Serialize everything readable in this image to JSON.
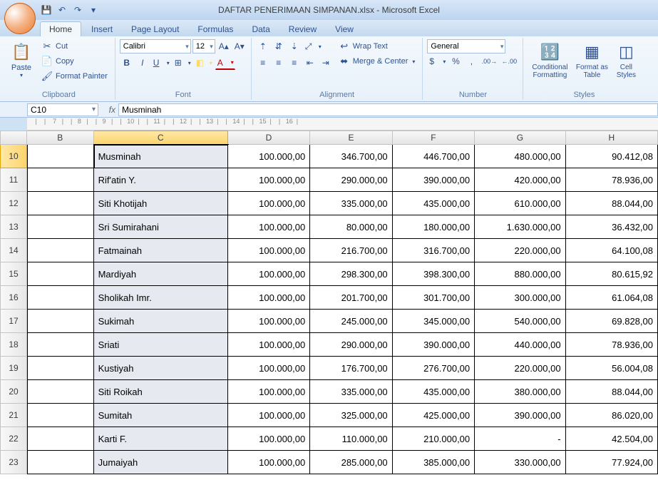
{
  "title": "DAFTAR PENERIMAAN SIMPANAN.xlsx - Microsoft Excel",
  "tabs": [
    "Home",
    "Insert",
    "Page Layout",
    "Formulas",
    "Data",
    "Review",
    "View"
  ],
  "activeTab": 0,
  "ribbon": {
    "clipboard": {
      "paste": "Paste",
      "cut": "Cut",
      "copy": "Copy",
      "format_painter": "Format Painter",
      "label": "Clipboard"
    },
    "font": {
      "name": "Calibri",
      "size": "12",
      "label": "Font"
    },
    "alignment": {
      "wrap": "Wrap Text",
      "merge": "Merge & Center",
      "label": "Alignment"
    },
    "number": {
      "format": "General",
      "label": "Number"
    },
    "styles": {
      "cond": "Conditional Formatting",
      "table": "Format as Table",
      "cell": "Cell Styles",
      "label": "Styles"
    }
  },
  "nameBox": "C10",
  "fx": "fx",
  "formulaValue": "Musminah",
  "columns": [
    "B",
    "C",
    "D",
    "E",
    "F",
    "G",
    "H"
  ],
  "selectedCol": "C",
  "selectedRowIndex": 0,
  "rows": [
    {
      "n": "10",
      "name": "Musminah",
      "d": "100.000,00",
      "e": "346.700,00",
      "f": "446.700,00",
      "g": "480.000,00",
      "h": "90.412,08"
    },
    {
      "n": "11",
      "name": "Rif'atin Y.",
      "d": "100.000,00",
      "e": "290.000,00",
      "f": "390.000,00",
      "g": "420.000,00",
      "h": "78.936,00"
    },
    {
      "n": "12",
      "name": "Siti Khotijah",
      "d": "100.000,00",
      "e": "335.000,00",
      "f": "435.000,00",
      "g": "610.000,00",
      "h": "88.044,00"
    },
    {
      "n": "13",
      "name": "Sri Sumirahani",
      "d": "100.000,00",
      "e": "80.000,00",
      "f": "180.000,00",
      "g": "1.630.000,00",
      "h": "36.432,00"
    },
    {
      "n": "14",
      "name": "Fatmainah",
      "d": "100.000,00",
      "e": "216.700,00",
      "f": "316.700,00",
      "g": "220.000,00",
      "h": "64.100,08"
    },
    {
      "n": "15",
      "name": "Mardiyah",
      "d": "100.000,00",
      "e": "298.300,00",
      "f": "398.300,00",
      "g": "880.000,00",
      "h": "80.615,92"
    },
    {
      "n": "16",
      "name": "Sholikah Imr.",
      "d": "100.000,00",
      "e": "201.700,00",
      "f": "301.700,00",
      "g": "300.000,00",
      "h": "61.064,08"
    },
    {
      "n": "17",
      "name": "Sukimah",
      "d": "100.000,00",
      "e": "245.000,00",
      "f": "345.000,00",
      "g": "540.000,00",
      "h": "69.828,00"
    },
    {
      "n": "18",
      "name": "Sriati",
      "d": "100.000,00",
      "e": "290.000,00",
      "f": "390.000,00",
      "g": "440.000,00",
      "h": "78.936,00"
    },
    {
      "n": "19",
      "name": "Kustiyah",
      "d": "100.000,00",
      "e": "176.700,00",
      "f": "276.700,00",
      "g": "220.000,00",
      "h": "56.004,08"
    },
    {
      "n": "20",
      "name": "Siti Roikah",
      "d": "100.000,00",
      "e": "335.000,00",
      "f": "435.000,00",
      "g": "380.000,00",
      "h": "88.044,00"
    },
    {
      "n": "21",
      "name": "Sumitah",
      "d": "100.000,00",
      "e": "325.000,00",
      "f": "425.000,00",
      "g": "390.000,00",
      "h": "86.020,00"
    },
    {
      "n": "22",
      "name": "Karti F.",
      "d": "100.000,00",
      "e": "110.000,00",
      "f": "210.000,00",
      "g": "-",
      "h": "42.504,00"
    },
    {
      "n": "23",
      "name": "Jumaiyah",
      "d": "100.000,00",
      "e": "285.000,00",
      "f": "385.000,00",
      "g": "330.000,00",
      "h": "77.924,00"
    }
  ],
  "icons": {
    "save": "💾",
    "undo": "↶",
    "redo": "↷",
    "qat_more": "▾",
    "paste": "📋",
    "cut": "✂",
    "copy": "📄",
    "brush": "🖌",
    "bold": "B",
    "italic": "I",
    "underline": "U",
    "border": "⊞",
    "fill": "◧",
    "fontcolor": "A",
    "grow": "A▴",
    "shrink": "A▾",
    "al": "≡",
    "ac": "≡",
    "ar": "≡",
    "top": "⇡",
    "mid": "⇵",
    "bot": "⇣",
    "indentl": "⇤",
    "indentr": "⇥",
    "orient": "⤢",
    "wrap": "↩",
    "merge": "⬌",
    "currency": "$",
    "percent": "%",
    "comma": ",",
    "inc": ".00→",
    "dec": "←.00",
    "cond": "🔢",
    "table": "▦",
    "cell": "◫"
  }
}
